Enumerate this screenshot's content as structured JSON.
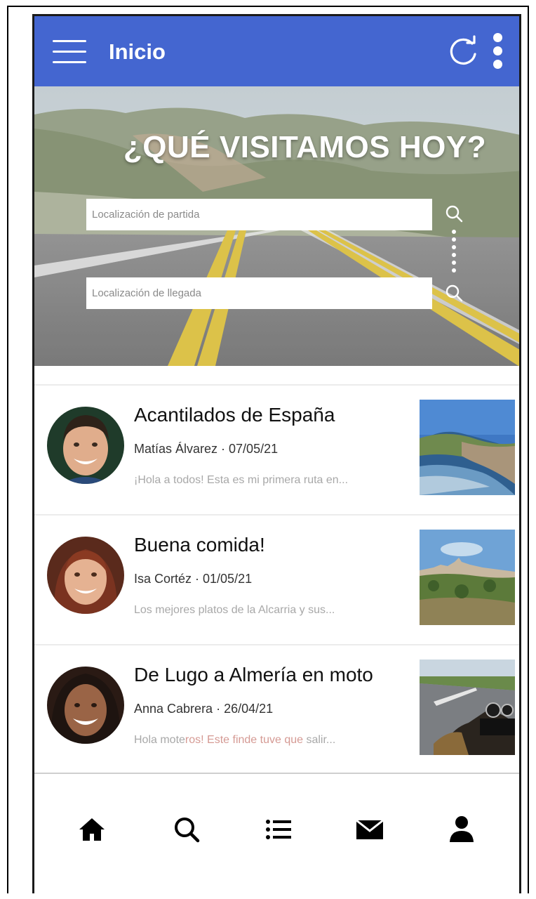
{
  "app_bar": {
    "title": "Inicio",
    "background": "#4466d0",
    "icons": [
      "menu-icon",
      "refresh-icon",
      "more-vert-icon"
    ]
  },
  "hero": {
    "title": "¿QUÉ VISITAMOS HOY?",
    "start_placeholder": "Localización de partida",
    "end_placeholder": "Localización de llegada"
  },
  "feed": {
    "items": [
      {
        "title": "Acantilados de España",
        "meta": "Matías Álvarez · 07/05/21",
        "excerpt": "¡Hola a todos! Esta es mi primera ruta en..."
      },
      {
        "title": "Buena comida!",
        "meta": "Isa Cortéz · 01/05/21",
        "excerpt": "Los mejores platos de la Alcarria y sus..."
      },
      {
        "title": "De Lugo a Almería en moto",
        "meta": "Anna Cabrera · 26/04/21",
        "excerpt_parts": [
          "Hola mote",
          "ros! Este finde tuve que ",
          "salir..."
        ]
      }
    ]
  },
  "bottom_nav": {
    "items": [
      "home-icon",
      "search-icon",
      "list-icon",
      "mail-icon",
      "profile-icon"
    ]
  }
}
